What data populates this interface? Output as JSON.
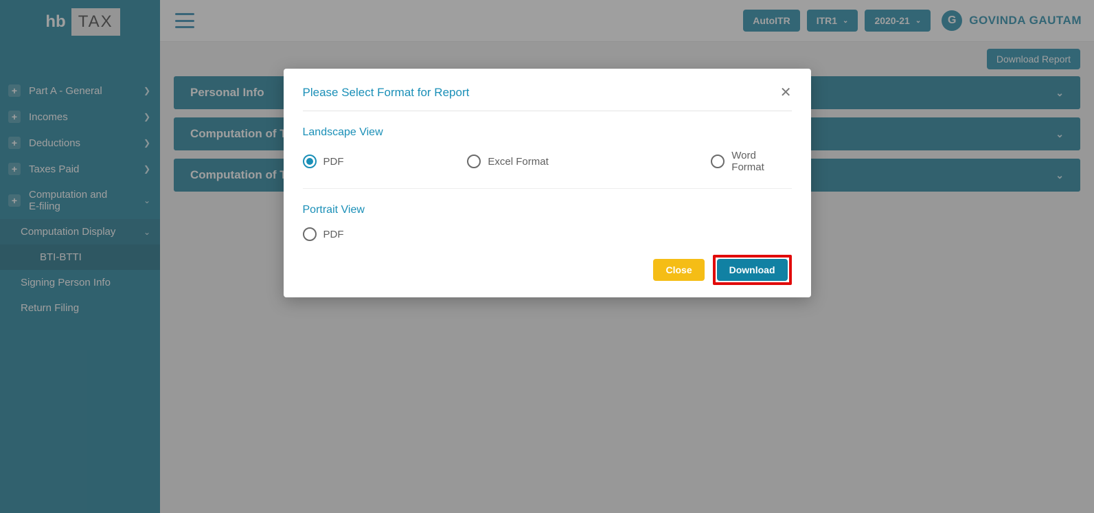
{
  "logo": {
    "left": "hb",
    "right": "TAX"
  },
  "sidebar": {
    "items": [
      {
        "label": "Part A - General"
      },
      {
        "label": "Incomes"
      },
      {
        "label": "Deductions"
      },
      {
        "label": "Taxes Paid"
      },
      {
        "label": "Computation and E-filing"
      }
    ],
    "sub": {
      "computation_display": "Computation Display",
      "bti_btti": "BTI-BTTI"
    },
    "plain": {
      "signing": "Signing Person Info",
      "return_filing": "Return Filing"
    }
  },
  "topbar": {
    "autoitr": "AutoITR",
    "itr": "ITR1",
    "year": "2020-21",
    "user_initial": "G",
    "user_name": "GOVINDA GAUTAM"
  },
  "content": {
    "download_report": "Download Report",
    "panels": [
      "Personal Info",
      "Computation of Total Income",
      "Computation of Tax"
    ]
  },
  "modal": {
    "title": "Please Select Format for Report",
    "landscape_title": "Landscape View",
    "portrait_title": "Portrait View",
    "options": {
      "pdf": "PDF",
      "excel": "Excel Format",
      "word": "Word Format",
      "pdf2": "PDF"
    },
    "close_btn": "Close",
    "download_btn": "Download",
    "close_x": "✕"
  }
}
